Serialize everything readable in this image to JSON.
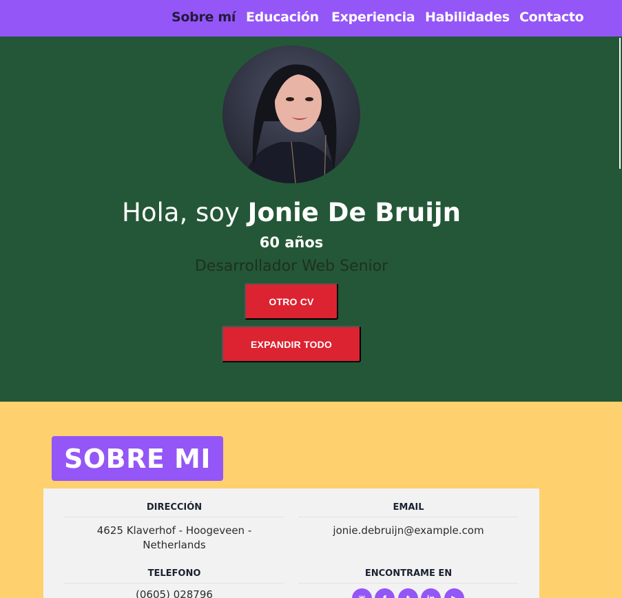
{
  "nav": {
    "items": [
      "Sobre mí",
      "Educación",
      "Experiencia",
      "Habilidades",
      "Contacto"
    ]
  },
  "hero": {
    "greeting_prefix": "Hola, soy",
    "name": "Jonie De Bruijn",
    "age": "60 años",
    "role": "Desarrollador Web Senior",
    "btn_otro": "Otro CV",
    "btn_expandir": "Expandir todo"
  },
  "about": {
    "heading": "SOBRE MI",
    "address_label": "DIRECCIÓN",
    "address_line1": "4625 Klaverhof - Hoogeveen -",
    "address_line2": "Netherlands",
    "email_label": "EMAIL",
    "email_value": "jonie.debruijn@example.com",
    "phone_label": "TELEFONO",
    "phone_value": "(0605) 028796",
    "social_label": "ENCONTRAME EN",
    "social_icons": [
      "instagram-icon",
      "facebook-icon",
      "twitter-icon",
      "linkedin-icon",
      "youtube-icon"
    ]
  },
  "colors": {
    "nav_bg": "#9456f7",
    "hero_bg": "#245737",
    "page_bg": "#fed06e",
    "button_red": "#dc2331",
    "card_bg": "#f2f2f2"
  }
}
